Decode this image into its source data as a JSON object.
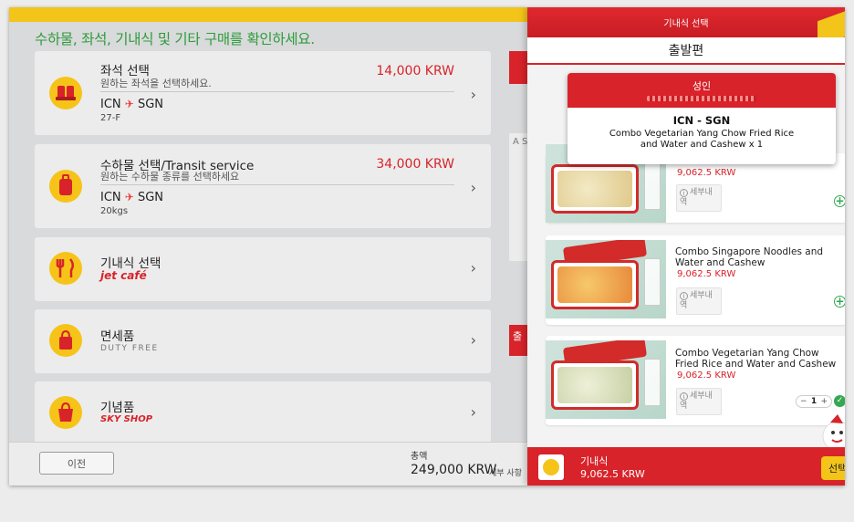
{
  "main": {
    "title": "수하물, 좌석, 기내식 및 기타 구매를 확인하세요.",
    "services": [
      {
        "name": "좌석 선택",
        "desc": "원하는 좌석을 선택하세요.",
        "price": "14,000 KRW",
        "from": "ICN",
        "to": "SGN",
        "sub": "27-F",
        "icon": "seat-icon"
      },
      {
        "name": "수하물 선택/Transit service",
        "desc": "원하는 수하물 종류를 선택하세요",
        "price": "34,000 KRW",
        "from": "ICN",
        "to": "SGN",
        "sub": "20kgs",
        "icon": "luggage-icon"
      },
      {
        "name": "기내식 선택",
        "brand": "jet café",
        "icon": "meal-icon"
      },
      {
        "name": "면세품",
        "brand": "DUTY FREE",
        "icon": "shopping-bag-icon"
      },
      {
        "name": "기념품",
        "brand": "SKY SHOP",
        "icon": "gift-bag-icon"
      }
    ],
    "behind_tab": "출",
    "behind_note": "A S"
  },
  "footer": {
    "prev_label": "이전",
    "total_label": "총액",
    "total_value": "249,000 KRW",
    "detail_label": "세부 사항"
  },
  "panel": {
    "header": "기내식 선택",
    "departure": "출발편",
    "summary": {
      "passenger": "성인",
      "route": "ICN - SGN",
      "item": "Combo Vegetarian Yang Chow Fried Rice and Water and Cashew x 1"
    },
    "meals": [
      {
        "name": "",
        "price": "9,062.5 KRW",
        "info": "세부내역",
        "action": "add"
      },
      {
        "name": "Combo Singapore Noodles and Water and Cashew",
        "price": "9,062.5 KRW",
        "info": "세부내역",
        "action": "add"
      },
      {
        "name": "Combo Vegetarian Yang Chow Fried Rice and Water and Cashew",
        "price": "9,062.5 KRW",
        "info": "세부내역",
        "action": "selected",
        "qty": "1"
      }
    ],
    "foot": {
      "title": "기내식",
      "price": "9,062.5 KRW",
      "select_label": "선택"
    }
  },
  "colors": {
    "accent_red": "#d8232a",
    "accent_yellow": "#f3c419",
    "title_green": "#2e9b3d",
    "confirm_green": "#34a853"
  }
}
